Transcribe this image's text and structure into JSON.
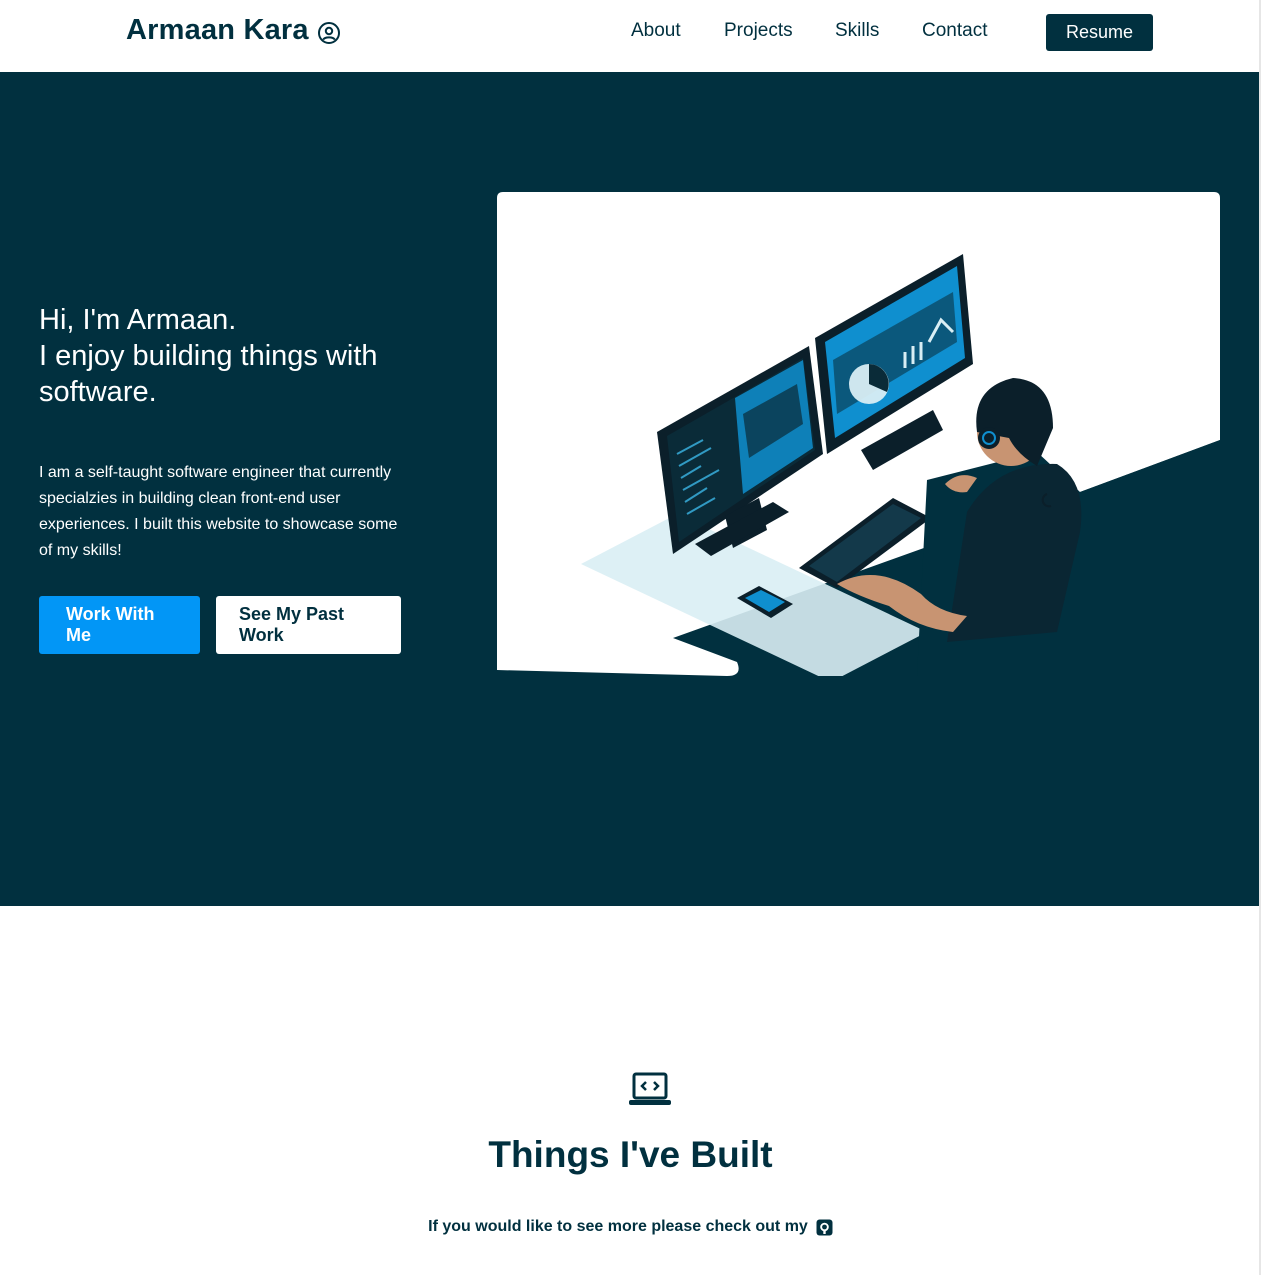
{
  "header": {
    "brand": "Armaan Kara",
    "brand_icon": "user-circle-icon",
    "nav": [
      "About",
      "Projects",
      "Skills",
      "Contact"
    ],
    "resume_label": "Resume"
  },
  "hero": {
    "title_line1": "Hi, I'm Armaan.",
    "title_line2": "I enjoy building things with software.",
    "description": "I am a self-taught software engineer that currently specialzies in building clean front-end user experiences. I built this website to showcase some of my skills!",
    "primary_cta": "Work With Me",
    "secondary_cta": "See My Past Work",
    "illustration": "developer-at-desk-illustration"
  },
  "projects": {
    "icon": "laptop-code-icon",
    "title": "Things I've Built",
    "subtitle": "If you would like to see more please check out my",
    "link_icon": "github-icon"
  },
  "colors": {
    "navy": "#01303f",
    "accent_blue": "#0296f6",
    "white": "#ffffff"
  }
}
